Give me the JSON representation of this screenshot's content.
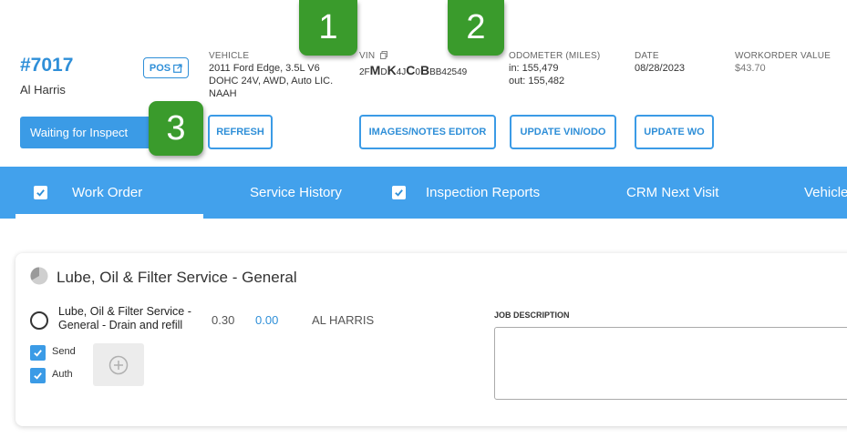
{
  "header": {
    "wo_number": "#7017",
    "customer": "Al Harris",
    "pos_label": "POS",
    "vehicle": {
      "label": "VEHICLE",
      "lines": [
        "2011 Ford Edge, 3.5L V6",
        "DOHC 24V, AWD, Auto LIC.",
        "NAAH"
      ]
    },
    "vin": {
      "label": "VIN",
      "parts": [
        "2F",
        "M",
        "D",
        "K",
        "4J",
        "C",
        "0",
        "B",
        "BB42549"
      ]
    },
    "odometer": {
      "label": "ODOMETER (MILES)",
      "in": "in: 155,479",
      "out": "out: 155,482"
    },
    "date": {
      "label": "DATE",
      "value": "08/28/2023"
    },
    "workorder_value": {
      "label": "WORKORDER VALUE",
      "value": "$43.70"
    }
  },
  "actions": {
    "status": "Waiting for Inspect",
    "refresh": "REFRESH",
    "images_notes": "IMAGES/NOTES EDITOR",
    "update_vin": "UPDATE VIN/ODO",
    "update_wo": "UPDATE WO"
  },
  "callouts": [
    "1",
    "2",
    "3"
  ],
  "tabs": [
    {
      "label": "Work Order",
      "checked": true
    },
    {
      "label": "Service History",
      "checked": false
    },
    {
      "label": "Inspection Reports",
      "checked": true
    },
    {
      "label": "CRM Next Visit",
      "checked": false
    },
    {
      "label": "Vehicle",
      "checked": false
    }
  ],
  "job": {
    "title": "Lube, Oil & Filter Service - General",
    "line_name": "Lube, Oil & Filter Service - General - Drain and refill",
    "hours": "0.30",
    "price": "0.00",
    "technician": "AL HARRIS",
    "send_label": "Send",
    "auth_label": "Auth",
    "description_label": "JOB DESCRIPTION"
  },
  "colors": {
    "accent": "#42a1ec",
    "callout": "#3a9b2c"
  }
}
